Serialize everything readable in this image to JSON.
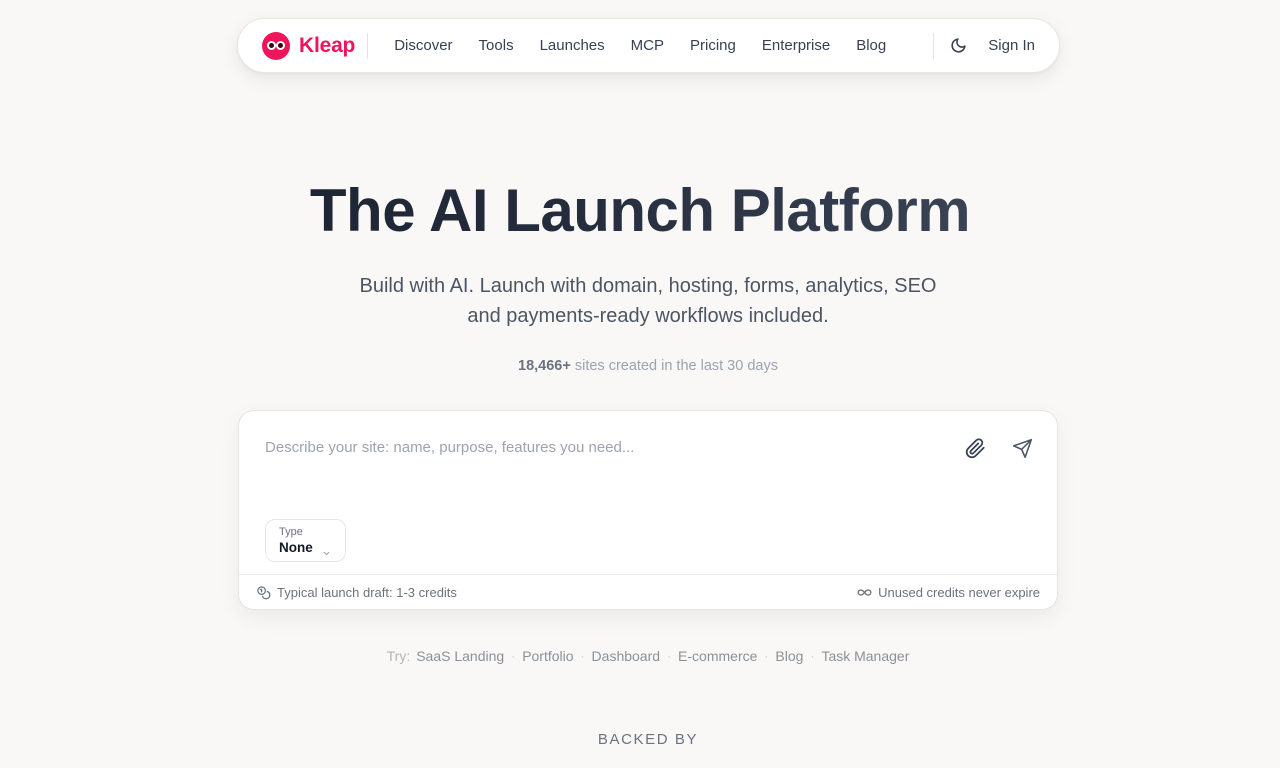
{
  "nav": {
    "brand": "Kleap",
    "links": [
      "Discover",
      "Tools",
      "Launches",
      "MCP",
      "Pricing",
      "Enterprise",
      "Blog"
    ],
    "sign_in": "Sign In",
    "theme_icon": "moon-icon"
  },
  "hero": {
    "title": "The AI Launch Platform",
    "subtitle_line1": "Build with AI. Launch with domain, hosting, forms, analytics, SEO",
    "subtitle_line2": "and payments-ready workflows included.",
    "stat_count": "18,466+",
    "stat_text": "sites created in the last 30 days"
  },
  "prompt_card": {
    "placeholder": "Describe your site: name, purpose, features you need...",
    "attach_icon": "paperclip-icon",
    "send_icon": "send-icon",
    "type_label": "Type",
    "type_value": "None",
    "footer_left": "Typical launch draft: 1-3 credits",
    "footer_right": "Unused credits never expire"
  },
  "suggestions": {
    "label": "Try:",
    "items": [
      "SaaS Landing",
      "Portfolio",
      "Dashboard",
      "E-commerce",
      "Blog",
      "Task Manager"
    ]
  },
  "backed_by": "BACKED BY",
  "colors": {
    "brand": "#f0145a",
    "background": "#f9f8f6"
  }
}
